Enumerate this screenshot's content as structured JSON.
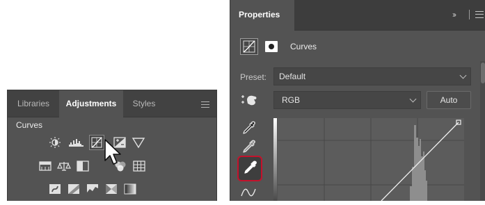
{
  "adjustments_panel": {
    "tabs": [
      {
        "label": "Libraries",
        "active": false
      },
      {
        "label": "Adjustments",
        "active": true
      },
      {
        "label": "Styles",
        "active": false
      }
    ],
    "hover_label": "Curves",
    "icon_rows": [
      [
        "brightness-contrast-icon",
        "levels-icon",
        "curves-icon",
        "exposure-icon",
        "gradient-triangle-icon"
      ],
      [
        "hue-saturation-icon",
        "color-balance-icon",
        "black-white-icon",
        "photo-filter-icon",
        "channel-mixer-icon",
        "color-lookup-icon"
      ],
      [
        "invert-icon",
        "posterize-icon",
        "threshold-icon",
        "selective-color-icon",
        "gradient-map-icon"
      ]
    ]
  },
  "properties_panel": {
    "tab_label": "Properties",
    "title": "Curves",
    "preset": {
      "label": "Preset:",
      "value": "Default"
    },
    "channel": {
      "value": "RGB"
    },
    "auto_label": "Auto",
    "tools": [
      "eyedropper-black-icon",
      "eyedropper-gray-icon",
      "eyedropper-white-icon",
      "curve-draw-icon"
    ],
    "highlighted_tool": "eyedropper-white-icon"
  },
  "colors": {
    "panel_bg": "#535353",
    "tab_bg": "#424242",
    "highlight_ring": "#c4122c"
  }
}
